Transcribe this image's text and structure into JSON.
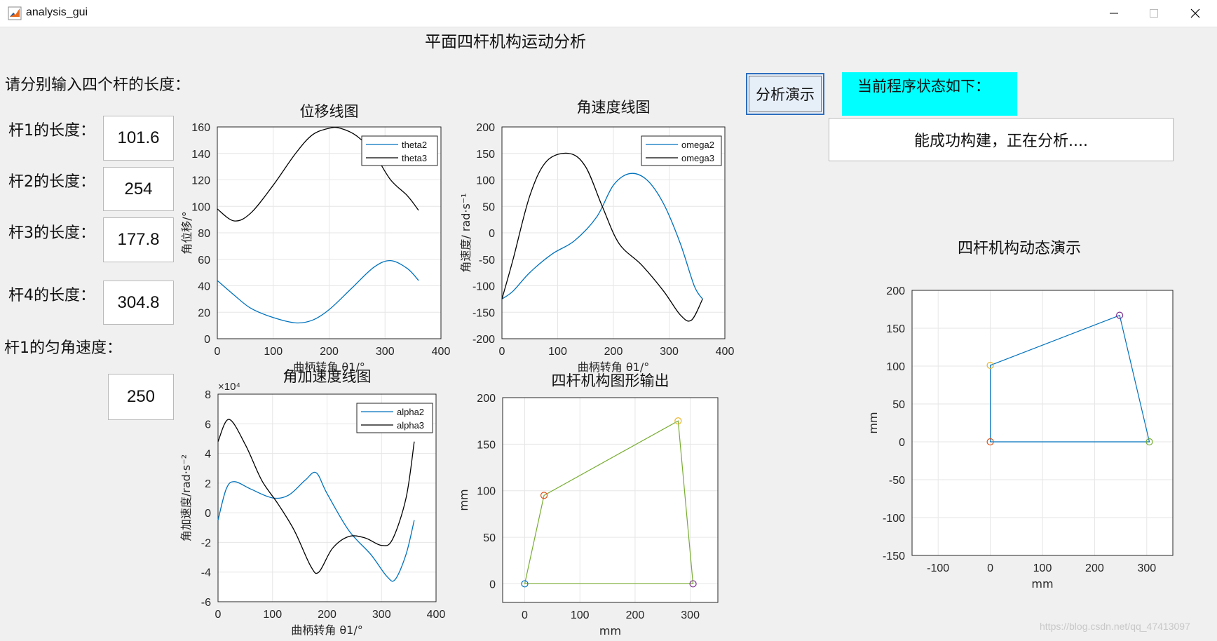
{
  "window": {
    "title": "analysis_gui",
    "icon": "matlab-icon",
    "controls": [
      "minimize-icon",
      "maximize-icon",
      "close-icon"
    ]
  },
  "app": {
    "title": "平面四杆机构运动分析",
    "prompt": "请分别输入四个杆的长度：",
    "rods": [
      {
        "label": "杆1的长度：",
        "value": "101.6"
      },
      {
        "label": "杆2的长度：",
        "value": "254"
      },
      {
        "label": "杆3的长度：",
        "value": "177.8"
      },
      {
        "label": "杆4的长度：",
        "value": "304.8"
      }
    ],
    "speed_label": "杆1的匀角速度：",
    "speed_value": "250",
    "analyze_button": "分析演示",
    "status_label": "当前程序状态如下：",
    "status_text": "能成功构建，正在分析....",
    "demo_title": "四杆机构动态演示",
    "watermark": "https://blog.csdn.net/qq_47413097"
  },
  "colors": {
    "series_blue": "#0072bd",
    "series_black": "#000000",
    "link_green": "#77ac30",
    "marker_orange": "#d95319",
    "marker_yellow": "#edb120",
    "marker_purple": "#7e2f8e",
    "status_cyan": "#00ffff"
  },
  "chart_data": [
    {
      "id": "displacement",
      "type": "line",
      "title": "位移线图",
      "xlabel": "曲柄转角 θ1/°",
      "ylabel": "角位移/°",
      "xlim": [
        0,
        400
      ],
      "ylim": [
        0,
        160
      ],
      "xticks": [
        0,
        100,
        200,
        300,
        400
      ],
      "yticks": [
        0,
        20,
        40,
        60,
        80,
        100,
        120,
        140,
        160
      ],
      "grid": true,
      "legend": "top-right",
      "series": [
        {
          "name": "theta2",
          "color": "#0072bd",
          "x": [
            0,
            30,
            60,
            100,
            140,
            170,
            200,
            240,
            280,
            310,
            340,
            360
          ],
          "y": [
            44,
            33,
            23,
            16,
            12,
            14,
            22,
            38,
            54,
            59,
            53,
            44
          ]
        },
        {
          "name": "theta3",
          "color": "#000000",
          "x": [
            0,
            30,
            60,
            100,
            140,
            170,
            200,
            220,
            250,
            280,
            310,
            340,
            360
          ],
          "y": [
            98,
            89,
            95,
            116,
            140,
            154,
            159,
            159,
            153,
            140,
            120,
            108,
            97
          ]
        }
      ]
    },
    {
      "id": "angular-velocity",
      "type": "line",
      "title": "角速度线图",
      "xlabel": "曲柄转角 θ1/°",
      "ylabel": "角速度/ rad·s⁻¹",
      "xlim": [
        0,
        400
      ],
      "ylim": [
        -200,
        200
      ],
      "xticks": [
        0,
        100,
        200,
        300,
        400
      ],
      "yticks": [
        -200,
        -150,
        -100,
        -50,
        0,
        50,
        100,
        150,
        200
      ],
      "grid": true,
      "legend": "top-right",
      "series": [
        {
          "name": "omega2",
          "color": "#0072bd",
          "x": [
            0,
            20,
            50,
            90,
            130,
            170,
            200,
            230,
            260,
            290,
            320,
            345,
            360
          ],
          "y": [
            -125,
            -110,
            -75,
            -40,
            -15,
            30,
            90,
            112,
            100,
            55,
            -20,
            -100,
            -125
          ]
        },
        {
          "name": "omega3",
          "color": "#000000",
          "x": [
            0,
            20,
            50,
            80,
            120,
            150,
            180,
            210,
            250,
            290,
            320,
            340,
            360
          ],
          "y": [
            -125,
            -50,
            70,
            135,
            150,
            125,
            50,
            -20,
            -60,
            -110,
            -155,
            -165,
            -125
          ]
        }
      ]
    },
    {
      "id": "angular-acceleration",
      "type": "line",
      "title": "角加速度线图",
      "xlabel": "曲柄转角 θ1/°",
      "ylabel": "角加速度/rad·s⁻²",
      "exponent_label": "×10⁴",
      "xlim": [
        0,
        400
      ],
      "ylim": [
        -6,
        8
      ],
      "xticks": [
        0,
        100,
        200,
        300,
        400
      ],
      "yticks": [
        -6,
        -4,
        -2,
        0,
        2,
        4,
        6,
        8
      ],
      "grid": true,
      "legend": "top-right",
      "series": [
        {
          "name": "alpha2",
          "color": "#0072bd",
          "x": [
            0,
            15,
            30,
            60,
            100,
            130,
            160,
            180,
            200,
            240,
            280,
            310,
            325,
            345,
            360
          ],
          "y": [
            -0.5,
            1.6,
            2.1,
            1.6,
            1.0,
            1.2,
            2.2,
            2.7,
            1.3,
            -1.2,
            -2.8,
            -4.3,
            -4.5,
            -2.8,
            -0.5
          ]
        },
        {
          "name": "alpha3",
          "color": "#000000",
          "x": [
            0,
            20,
            50,
            80,
            110,
            140,
            170,
            185,
            210,
            240,
            270,
            300,
            320,
            345,
            360
          ],
          "y": [
            4.8,
            6.3,
            4.6,
            2.2,
            0.6,
            -1.2,
            -3.6,
            -4.0,
            -2.4,
            -1.6,
            -1.7,
            -2.2,
            -1.8,
            1.0,
            4.8
          ]
        }
      ]
    },
    {
      "id": "mechanism-output",
      "type": "scatter",
      "title": "四杆机构图形输出",
      "xlabel": "mm",
      "ylabel": "mm",
      "xlim": [
        -40,
        350
      ],
      "ylim": [
        -20,
        200
      ],
      "xticks": [
        0,
        100,
        200,
        300
      ],
      "yticks": [
        0,
        50,
        100,
        150,
        200
      ],
      "grid": true,
      "polygon": {
        "x": [
          0,
          35,
          278,
          305,
          0
        ],
        "y": [
          0,
          95,
          175,
          0,
          0
        ],
        "color": "#77ac30"
      },
      "joints": [
        {
          "x": 0,
          "y": 0,
          "color": "#0072bd"
        },
        {
          "x": 35,
          "y": 95,
          "color": "#d95319"
        },
        {
          "x": 278,
          "y": 175,
          "color": "#edb120"
        },
        {
          "x": 305,
          "y": 0,
          "color": "#7e2f8e"
        }
      ]
    },
    {
      "id": "dynamic-demo",
      "type": "scatter",
      "title": "",
      "xlabel": "mm",
      "ylabel": "mm",
      "xlim": [
        -150,
        350
      ],
      "ylim": [
        -150,
        200
      ],
      "xticks": [
        -100,
        0,
        100,
        200,
        300
      ],
      "yticks": [
        -150,
        -100,
        -50,
        0,
        50,
        100,
        150,
        200
      ],
      "grid": true,
      "polygon": {
        "x": [
          0,
          0,
          248,
          305,
          0
        ],
        "y": [
          0,
          101,
          167,
          0,
          0
        ],
        "color": "#0072bd"
      },
      "joints": [
        {
          "x": 0,
          "y": 0,
          "color": "#d95319"
        },
        {
          "x": 0,
          "y": 101,
          "color": "#edb120"
        },
        {
          "x": 248,
          "y": 167,
          "color": "#7e2f8e"
        },
        {
          "x": 305,
          "y": 0,
          "color": "#77ac30"
        }
      ]
    }
  ]
}
